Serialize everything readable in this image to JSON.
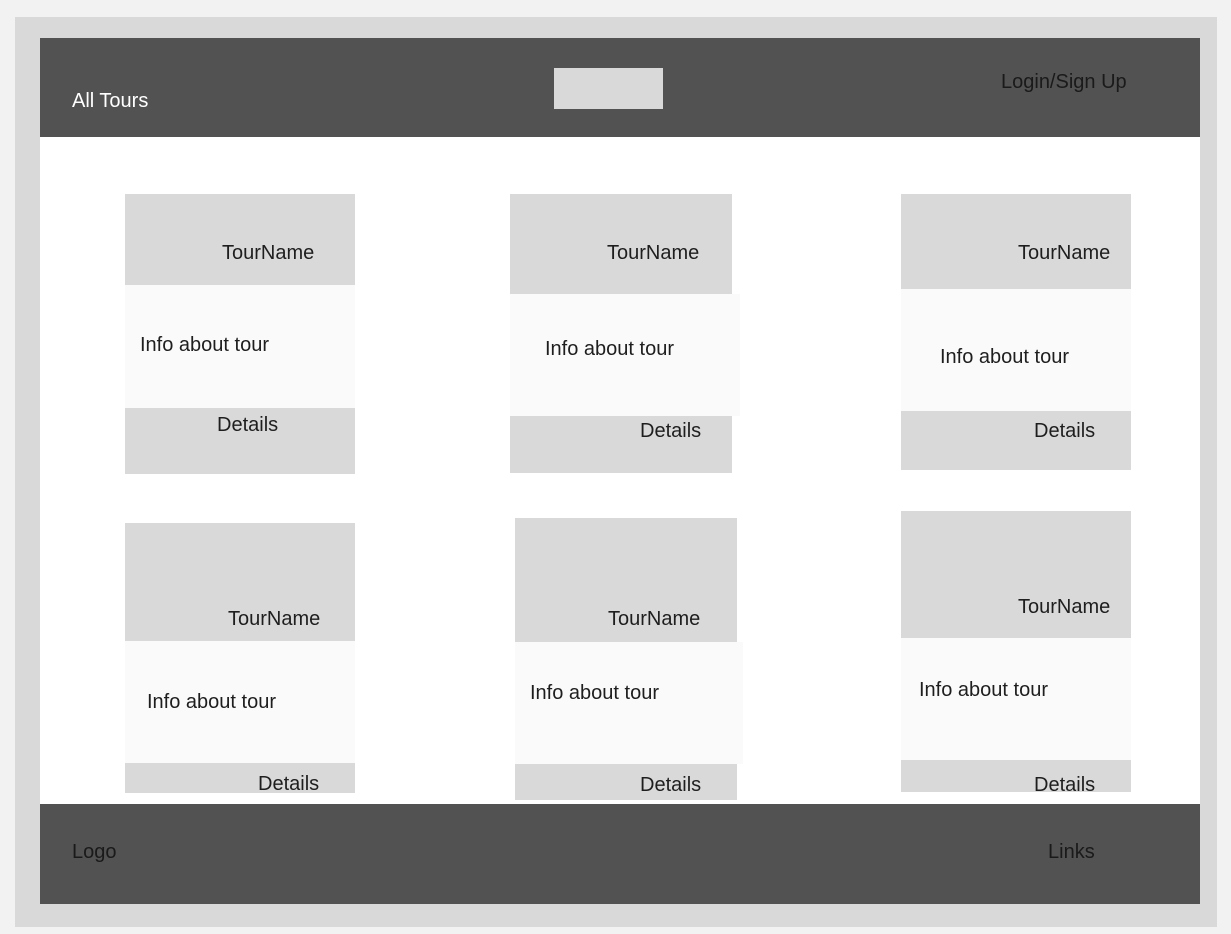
{
  "header": {
    "all_tours_label": "All Tours",
    "login_label": "Login/Sign Up"
  },
  "tours": [
    {
      "name": "TourName",
      "info": "Info about tour",
      "details_label": "Details"
    },
    {
      "name": "TourName",
      "info": "Info about tour",
      "details_label": "Details"
    },
    {
      "name": "TourName",
      "info": "Info about tour",
      "details_label": "Details"
    },
    {
      "name": "TourName",
      "info": "Info about tour",
      "details_label": "Details"
    },
    {
      "name": "TourName",
      "info": "Info about tour",
      "details_label": "Details"
    },
    {
      "name": "TourName",
      "info": "Info about tour",
      "details_label": "Details"
    }
  ],
  "footer": {
    "logo_label": "Logo",
    "links_label": "Links"
  }
}
